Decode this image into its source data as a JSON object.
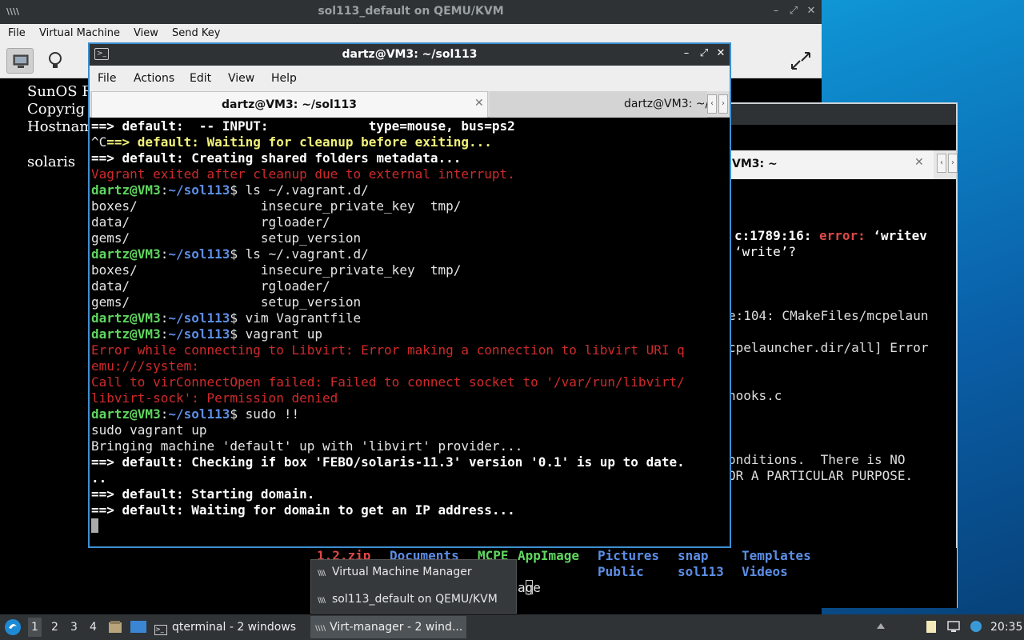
{
  "vm_window": {
    "title": "sol113_default on QEMU/KVM",
    "menu": [
      "File",
      "Virtual Machine",
      "View",
      "Send Key"
    ],
    "console_lines": [
      "SunOS R",
      "Copyrig",
      "Hostnam",
      "",
      "solaris"
    ]
  },
  "term2": {
    "tab_label": "VM3: ~",
    "lines": [
      {
        "pre": "c:1789:16: ",
        "err": "error:",
        "post": " ‘writev"
      },
      {
        "pre": "‘write’?",
        "err": "",
        "post": ""
      },
      {
        "pre": "e:104: CMakeFiles/mcpelaun",
        "err": "",
        "post": ""
      },
      {
        "pre": "cpelauncher.dir/all] Error",
        "err": "",
        "post": ""
      },
      {
        "pre": "hooks.c",
        "err": "",
        "post": ""
      },
      {
        "pre": "onditions.  There is NO",
        "err": "",
        "post": ""
      },
      {
        "pre": "OR A PARTICULAR PURPOSE.",
        "err": "",
        "post": ""
      }
    ]
  },
  "terminal": {
    "title": "dartz@VM3: ~/sol113",
    "menu": [
      "File",
      "Actions",
      "Edit",
      "View",
      "Help"
    ],
    "tabs": [
      {
        "label": "dartz@VM3: ~/sol113"
      },
      {
        "label": "dartz@VM3: ~/"
      }
    ],
    "prompt_user": "dartz@VM3",
    "prompt_path": "~/sol113",
    "lines": {
      "l1": "==> default:  -- INPUT:             type=mouse, bus=ps2",
      "l2a": "^C",
      "l2b": "==> default: Waiting for cleanup before exiting...",
      "l3": "==> default: Creating shared folders metadata...",
      "l4": "Vagrant exited after cleanup due to external interrupt.",
      "cmd1": "$ ls ~/.vagrant.d/",
      "ls1": "boxes/                insecure_private_key  tmp/",
      "ls2": "data/                 rgloader/",
      "ls3": "gems/                 setup_version",
      "cmd2": "$ ls ~/.vagrant.d/",
      "ls4": "boxes/                insecure_private_key  tmp/",
      "ls5": "data/                 rgloader/",
      "ls6": "gems/                 setup_version",
      "cmd3": "$ vim Vagrantfile",
      "cmd4": "$ vagrant up",
      "e1": "Error while connecting to Libvirt: Error making a connection to libvirt URI q",
      "e2": "emu:///system:",
      "e3": "Call to virConnectOpen failed: Failed to connect socket to '/var/run/libvirt/",
      "e4": "libvirt-sock': Permission denied",
      "cmd5": "$ sudo !!",
      "o1": "sudo vagrant up",
      "o2": "Bringing machine 'default' up with 'libvirt' provider...",
      "o3": "==> default: Checking if box 'FEBO/solaris-11.3' version '0.1' is up to date.",
      "o4": "..",
      "o5": "==> default: Starting domain.",
      "o6": "==> default: Waiting for domain to get an IP address..."
    }
  },
  "ls_strip": {
    "row1": [
      "1.2.zip",
      "Documents",
      "MCPE",
      "AppImage",
      "Pictures",
      "snap",
      "Templates"
    ],
    "row2": [
      "Public",
      "sol113",
      "Videos"
    ],
    "prompt_tail": "age"
  },
  "popup": {
    "items": [
      "Virtual Machine Manager",
      "sol113_default on QEMU/KVM"
    ]
  },
  "taskbar": {
    "workspaces": [
      "1",
      "2",
      "3",
      "4"
    ],
    "tasks": [
      "qterminal - 2 windows",
      "Virt-manager - 2 wind..."
    ],
    "clock": "20:35"
  }
}
